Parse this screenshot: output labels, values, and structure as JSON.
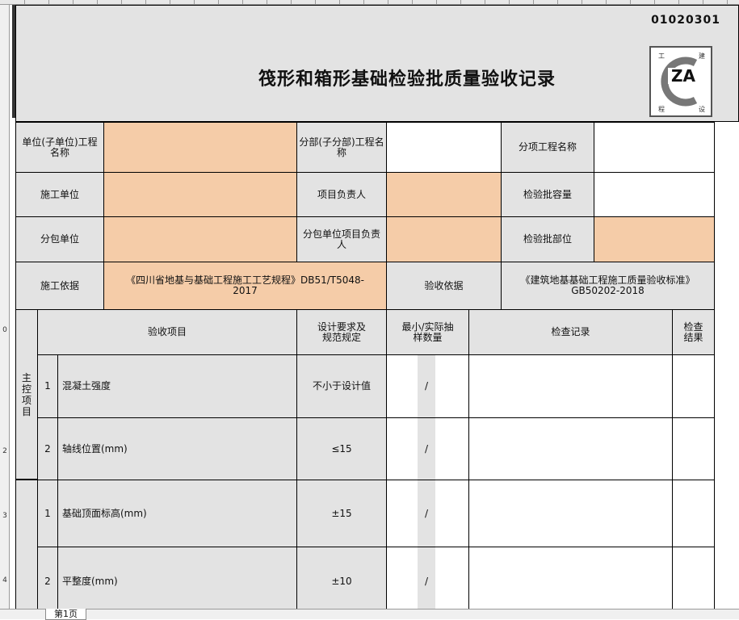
{
  "sheet": {
    "code": "01020301",
    "title": "筏形和箱形基础检验批质量验收记录",
    "logo": {
      "text": "ZA",
      "corners": [
        "工",
        "建",
        "程",
        "设"
      ]
    }
  },
  "colors": {
    "header_fill": "#e3e3e3",
    "input_fill": "#f5cca8",
    "border": "#000000"
  },
  "info": {
    "unit_label": "单位(子单位)工程名称",
    "division_label": "分部(子分部)工程名称",
    "item_label": "分项工程名称",
    "contractor_label": "施工单位",
    "project_lead_label": "项目负责人",
    "batch_capacity_label": "检验批容量",
    "subcontractor_label": "分包单位",
    "sub_lead_label": "分包单位项目负责人",
    "batch_location_label": "检验批部位",
    "construction_basis_label": "施工依据",
    "construction_basis_value": "《四川省地基与基础工程施工工艺规程》DB51/T5048-2017",
    "acceptance_basis_label": "验收依据",
    "acceptance_basis_value": "《建筑地基基础工程施工质量验收标准》GB50202-2018"
  },
  "headers": {
    "item": "验收项目",
    "design": "设计要求及规范规定",
    "sample": "最小/实际抽样数量",
    "record": "检查记录",
    "result": "检查结果"
  },
  "main_control_label": "主控项目",
  "rows": [
    {
      "no": "1",
      "name": "混凝土强度",
      "req": "不小于设计值",
      "slash": "/"
    },
    {
      "no": "2",
      "name": "轴线位置(mm)",
      "req": "≤15",
      "slash": "/"
    },
    {
      "no": "1",
      "name": "基础顶面标高(mm)",
      "req": "±15",
      "slash": "/"
    },
    {
      "no": "2",
      "name": "平整度(mm)",
      "req": "±10",
      "slash": "/"
    }
  ],
  "row_numbers": [
    "0",
    "2",
    "3",
    "4"
  ],
  "tab": {
    "label": "第1页"
  }
}
